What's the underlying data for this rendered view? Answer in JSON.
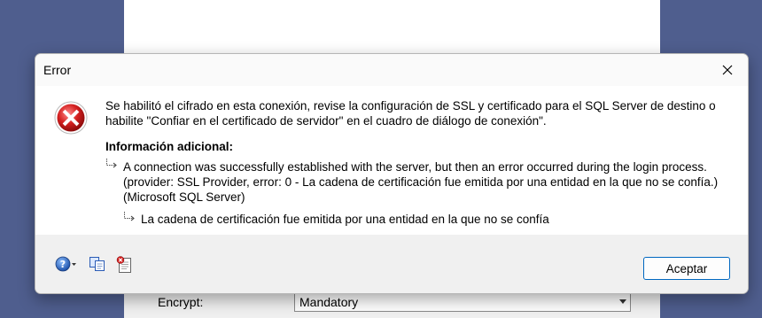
{
  "dialog": {
    "title": "Error",
    "message": "Se habilitó el cifrado en esta conexión, revise la configuración de SSL y certificado para el SQL Server de destino o habilite \"Confiar en el certificado de servidor\" en el cuadro de diálogo de conexión\".",
    "additional_info_heading": "Información adicional:",
    "detail_1": "A connection was successfully established with the server, but then an error occurred during the login process. (provider: SSL Provider, error: 0 - La cadena de certificación fue emitida por una entidad en la que no se confía.) (Microsoft SQL Server)",
    "detail_2": "La cadena de certificación fue emitida por una entidad en la que no se confía",
    "accept_label": "Aceptar"
  },
  "background": {
    "encrypt_label": "Encrypt:",
    "encrypt_value": "Mandatory"
  },
  "icons": {
    "error": "error-icon",
    "help": "help-icon",
    "copy": "copy-icon",
    "details": "details-icon",
    "close": "close-icon",
    "arrow": "sub-item-arrow-icon"
  }
}
